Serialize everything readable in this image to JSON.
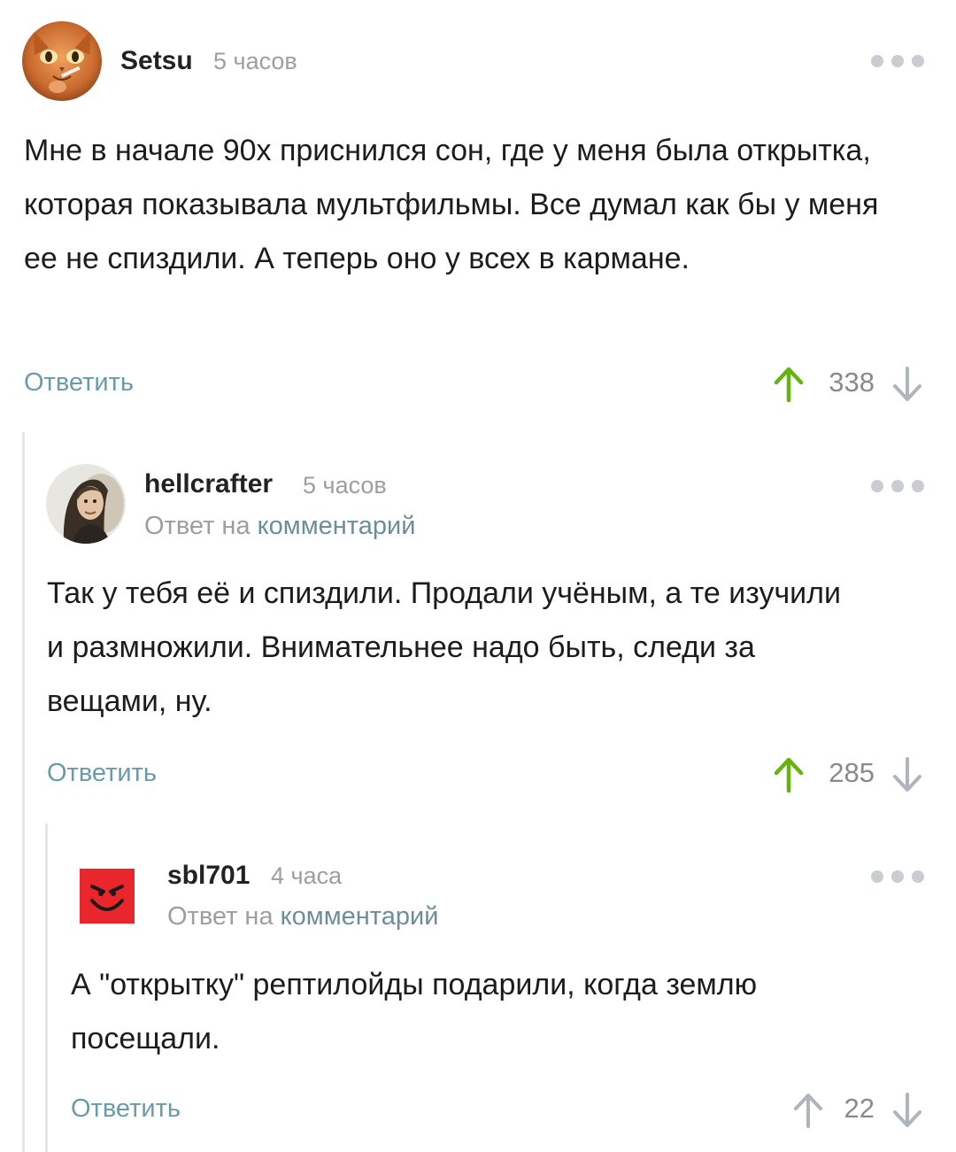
{
  "colors": {
    "upvote_active": "#64b40f",
    "upvote_neutral": "#aeb5bb",
    "reply_link": "#6b9bab",
    "meta_text": "#9e9e9e",
    "thread_line": "#e6e6e6"
  },
  "comments": [
    {
      "author": "Setsu",
      "time": "5 часов",
      "avatar_icon": "cat-avatar",
      "text": "Мне в начале 90х приснился сон, где у меня была открытка, которая показывала мультфильмы. Все думал как бы у меня ее не спиздили. А теперь оно у всех в кармане.",
      "reply_label": "Ответить",
      "score": "338",
      "upvoted": true
    },
    {
      "author": "hellcrafter",
      "time": "5 часов",
      "avatar_icon": "person-photo-avatar",
      "reply_to_prefix": "Ответ на",
      "reply_to_link": "комментарий",
      "text": "Так у тебя её и спиздили. Продали учёным, а те изучили и размножили. Внимательнее надо быть, следи за вещами, ну.",
      "reply_label": "Ответить",
      "score": "285",
      "upvoted": true
    },
    {
      "author": "sbl701",
      "time": "4 часа",
      "avatar_icon": "devil-smiley-avatar",
      "reply_to_prefix": "Ответ на",
      "reply_to_link": "комментарий",
      "text": "А \"открытку\" рептилойды подарили, когда землю посещали.",
      "reply_label": "Ответить",
      "score": "22",
      "upvoted": false
    }
  ]
}
